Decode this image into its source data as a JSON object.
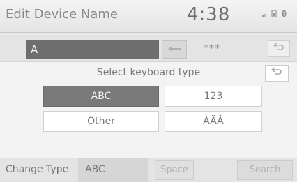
{
  "header": {
    "title": "Edit Device Name",
    "clock": "4:38",
    "status_icons": [
      "signal-icon",
      "phone-battery-icon",
      "bluetooth-icon"
    ]
  },
  "input": {
    "value": "A",
    "masked_text": "***",
    "backspace_icon": "arrow-left-icon",
    "back_icon": "return-arrow-icon"
  },
  "keyboard_type_panel": {
    "title": "Select keyboard type",
    "back_icon": "return-arrow-icon",
    "options": [
      {
        "label": "ABC",
        "selected": true
      },
      {
        "label": "123",
        "selected": false
      },
      {
        "label": "Other",
        "selected": false
      },
      {
        "label": "ÀÄÂ",
        "selected": false
      }
    ]
  },
  "bottom_bar": {
    "change_type_label": "Change Type",
    "current_type": "ABC",
    "space_label": "Space",
    "search_label": "Search"
  }
}
